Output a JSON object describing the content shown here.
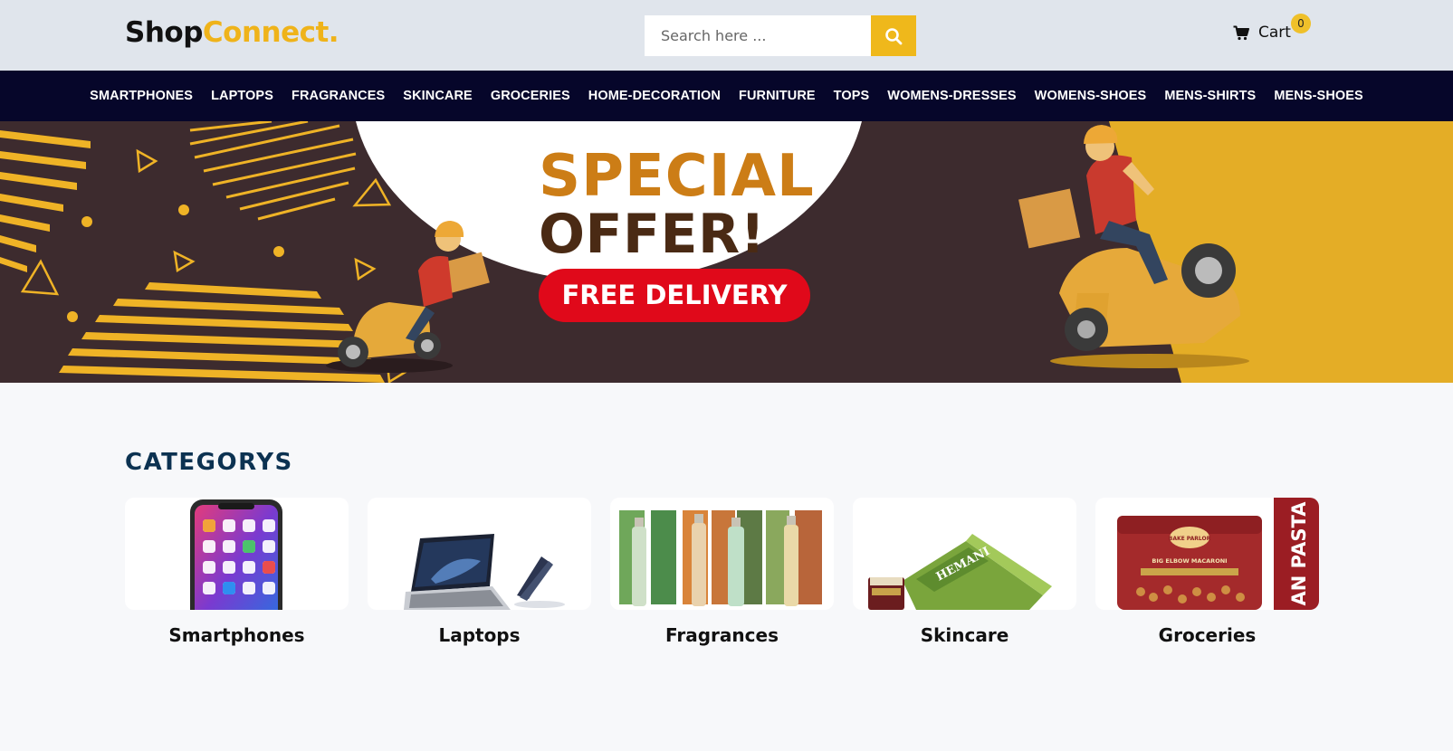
{
  "header": {
    "logo_part1": "Shop",
    "logo_part2": "Connect.",
    "search_placeholder": "Search here ...",
    "search_icon": "search-icon",
    "cart_label": "Cart",
    "cart_count": "0",
    "cart_icon": "cart-icon"
  },
  "nav": {
    "items": [
      "SMARTPHONES",
      "LAPTOPS",
      "FRAGRANCES",
      "SKINCARE",
      "GROCERIES",
      "HOME-DECORATION",
      "FURNITURE",
      "TOPS",
      "WOMENS-DRESSES",
      "WOMENS-SHOES",
      "MENS-SHIRTS",
      "MENS-SHOES"
    ]
  },
  "banner": {
    "line1": "SPECIAL",
    "line2": "OFFER!",
    "pill": "FREE DELIVERY"
  },
  "categories": {
    "title": "CATEGORYS",
    "items": [
      {
        "label": "Smartphones"
      },
      {
        "label": "Laptops"
      },
      {
        "label": "Fragrances"
      },
      {
        "label": "Skincare"
      },
      {
        "label": "Groceries"
      }
    ],
    "product_texts": {
      "skincare_brand": "HEMANI",
      "grocery_brand": "BAKE PARLOR",
      "grocery_product": "BIG ELBOW MACARONI",
      "grocery_side": "AN PASTA"
    }
  },
  "colors": {
    "accent": "#efb81b",
    "nav_bg": "#06062a",
    "banner_bg": "#3d2b2e",
    "title": "#0c3251"
  }
}
